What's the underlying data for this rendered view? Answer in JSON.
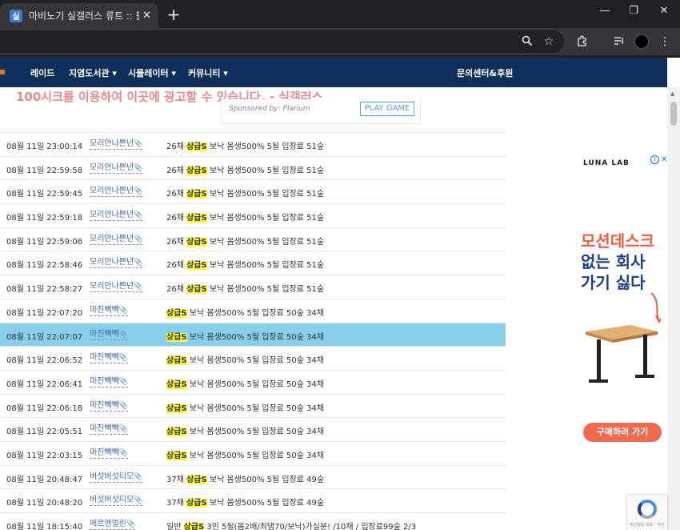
{
  "browser": {
    "tab_favicon": "실",
    "tab_title": "마비노기 실갤러스 류트 :: 뿔피",
    "tab_close": "✕",
    "new_tab": "+",
    "window_controls": {
      "minimize": "—",
      "restore": "❐",
      "close": "✕"
    },
    "toolbar_icons": [
      "zoom-icon",
      "star-icon",
      "extensions-icon",
      "media-icon",
      "profile-avatar",
      "menu-icon"
    ]
  },
  "nav": {
    "items": [
      "레이드",
      "지염도서관 ▾",
      "시뮬레이터 ▾",
      "커뮤니티 ▾"
    ],
    "right": "문의센터&후원"
  },
  "ad_banner": {
    "text": "100시크를 이용하여 이곳에 광고할 수 있습니다. - 실갤러스",
    "sponsor": "Sponsored by: Plarium",
    "play": "PLAY GAME"
  },
  "rows": [
    {
      "time": "08월 11일 23:00:14",
      "user": "모리안나쁜년",
      "pre": "26채 ",
      "mark": "상급S",
      "post": " 보낙 몸생500% 5될 입장료 51숲"
    },
    {
      "time": "08월 11일 22:59:58",
      "user": "모리안나쁜년",
      "pre": "26채 ",
      "mark": "상급S",
      "post": " 보낙 몸생500% 5될 입장료 51숲"
    },
    {
      "time": "08월 11일 22:59:45",
      "user": "모리안나쁜년",
      "pre": "26채 ",
      "mark": "상급S",
      "post": " 보낙 몸생500% 5될 입장료 51숲"
    },
    {
      "time": "08월 11일 22:59:18",
      "user": "모리안나쁜년",
      "pre": "26채 ",
      "mark": "상급S",
      "post": " 보낙 몸생500% 5될 입장료 51숲"
    },
    {
      "time": "08월 11일 22:59:06",
      "user": "모리안나쁜년",
      "pre": "26채 ",
      "mark": "상급S",
      "post": " 보낙 몸생500% 5될 입장료 51숲"
    },
    {
      "time": "08월 11일 22:58:46",
      "user": "모리안나쁜년",
      "pre": "26채 ",
      "mark": "상급S",
      "post": " 보낙 몸생500% 5될 입장료 51숲"
    },
    {
      "time": "08월 11일 22:58:27",
      "user": "모리안나쁜년",
      "pre": "26채 ",
      "mark": "상급S",
      "post": " 보낙 몸생500% 5될 입장료 51숲"
    },
    {
      "time": "08월 11일 22:07:20",
      "user": "마진빽빽",
      "pre": "",
      "mark": "상급S",
      "post": " 보낙 몸생500% 5될 입장료 50숲 34채"
    },
    {
      "time": "08월 11일 22:07:07",
      "user": "마진빽빽",
      "pre": "",
      "mark": "상급S",
      "post": " 보낙 몸생500% 5될 입장료 50숲 34채"
    },
    {
      "time": "08월 11일 22:06:52",
      "user": "마진빽빽",
      "pre": "",
      "mark": "상급S",
      "post": " 보낙 몸생500% 5될 입장료 50숲 34채"
    },
    {
      "time": "08월 11일 22:06:41",
      "user": "마진빽빽",
      "pre": "",
      "mark": "상급S",
      "post": " 보낙 몸생500% 5될 입장료 50숲 34채"
    },
    {
      "time": "08월 11일 22:06:18",
      "user": "마진빽빽",
      "pre": "",
      "mark": "상급S",
      "post": " 보낙 몸생500% 5될 입장료 50숲 34채"
    },
    {
      "time": "08월 11일 22:05:51",
      "user": "마진빽빽",
      "pre": "",
      "mark": "상급S",
      "post": " 보낙 몸생500% 5될 입장료 50숲 34채"
    },
    {
      "time": "08월 11일 22:03:15",
      "user": "마진빽빽",
      "pre": "",
      "mark": "상급S",
      "post": " 보낙 몸생500% 5될 입장료 50숲 34채"
    },
    {
      "time": "08월 11일 20:48:47",
      "user": "버섯버섯티모",
      "pre": "37채 ",
      "mark": "상급S",
      "post": " 보낙 몸생500% 5될 입장료 49숲"
    },
    {
      "time": "08월 11일 20:48:20",
      "user": "버섯버섯티모",
      "pre": "37채 ",
      "mark": "상급S",
      "post": " 보낙 몸생500% 5될 입장료 49숲"
    },
    {
      "time": "08월 11일 18:15:40",
      "user": "메르엔멀린",
      "pre": "일반 ",
      "mark": "상급S",
      "post": " 3인 5될(몸2배/최댐70/보낙)가실분! /10채 / 입장료99숲 2/3"
    }
  ],
  "highlight_color": "#87ceeb",
  "side_ad": {
    "brand": "LUNA LAB",
    "info": "i",
    "close": "✕",
    "headline1": "모션데스크",
    "headline2": "없는 회사",
    "headline3": "가기 싫다",
    "button": "구매하러 가기"
  },
  "recaptcha": {
    "small": "개인정보 보호 - 약관"
  }
}
